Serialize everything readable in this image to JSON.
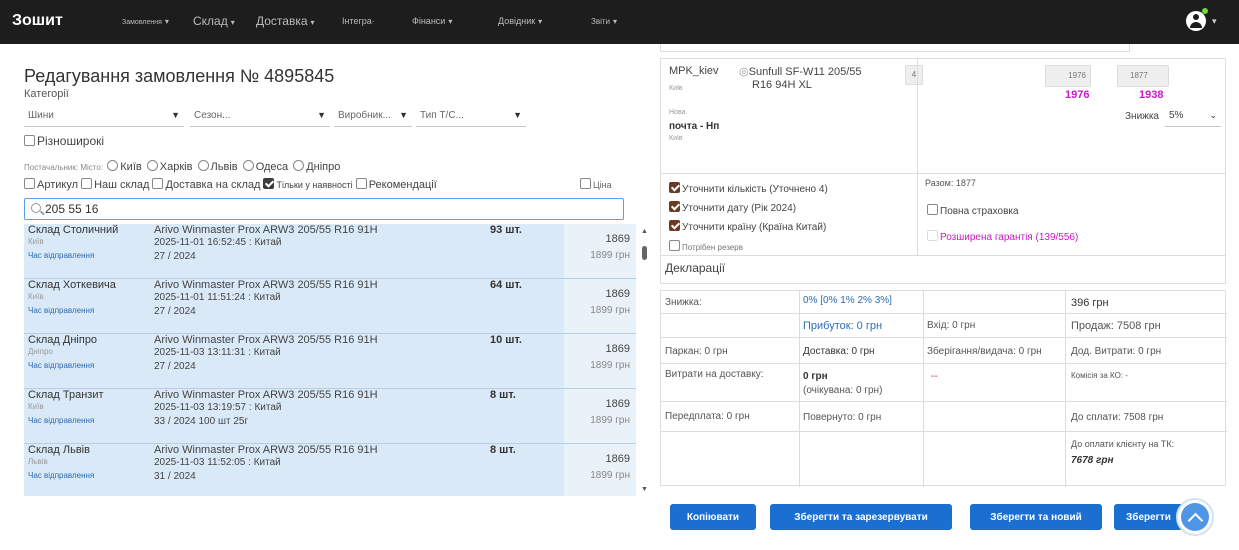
{
  "app": {
    "title": "Зошит"
  },
  "nav": [
    "Замовлення",
    "Склад",
    "Доставка",
    "Інтегра·",
    "Фінанси",
    "Довідник",
    "Звіти"
  ],
  "left": {
    "page_title": "Редагування замовлення № 4895845",
    "categories_label": "Категорії",
    "filters": {
      "type": "Шини",
      "season": "Сезон...",
      "manufacturer": "Виробник...",
      "vehicle": "Тип Т/С..."
    },
    "wide_label": "Різноширокі",
    "suppliers_prefix": "Постачальник: Місто:",
    "cities": [
      "Київ",
      "Харків",
      "Львів",
      "Одеса",
      "Дніпро"
    ],
    "options": {
      "article": "Артикул",
      "our_warehouse": "Наш склад",
      "delivery_warehouse": "Доставка на склад",
      "in_stock": "Тільки у наявності",
      "recommendations": "Рекомендації",
      "price": "Ціна"
    },
    "search_value": "205 55 16",
    "rows": [
      {
        "warehouse": "Склад Столичний",
        "city": "Київ",
        "ship": "Час відправлення",
        "name": "Arivo Winmaster Prox ARW3 205/55 R16 91H",
        "date": "2025-11-01 16:52:45 : Китай",
        "year": "27 / 2024",
        "qty": "93 шт.",
        "price": "1869",
        "price_old": "1899 грн"
      },
      {
        "warehouse": "Склад Хоткевича",
        "city": "Київ",
        "ship": "Час відправлення",
        "name": "Arivo Winmaster Prox ARW3 205/55 R16 91H",
        "date": "2025-11-01 11:51:24 : Китай",
        "year": "27 / 2024",
        "qty": "64 шт.",
        "price": "1869",
        "price_old": "1899 грн"
      },
      {
        "warehouse": "Склад Дніпро",
        "city": "Дніпро",
        "ship": "Час відправлення",
        "name": "Arivo Winmaster Prox ARW3 205/55 R16 91H",
        "date": "2025-11-03 13:11:31 : Китай",
        "year": "27 / 2024",
        "qty": "10 шт.",
        "price": "1869",
        "price_old": "1899 грн"
      },
      {
        "warehouse": "Склад Транзит",
        "city": "Київ",
        "ship": "Час відправлення",
        "name": "Arivo Winmaster Prox ARW3 205/55 R16 91H",
        "date": "2025-11-03 13:19:57 : Китай",
        "year": "33 / 2024 100 шт 25г",
        "qty": "8 шт.",
        "price": "1869",
        "price_old": "1899 грн"
      },
      {
        "warehouse": "Склад Львів",
        "city": "Львів",
        "ship": "Час відправлення",
        "name": "Arivo Winmaster Prox ARW3 205/55 R16 91H",
        "date": "2025-11-03 11:52:05 : Китай",
        "year": "31 / 2024",
        "qty": "8 шт.",
        "price": "1869",
        "price_old": "1899 грн"
      }
    ]
  },
  "right": {
    "item": {
      "supplier": "MPK_kiev",
      "supplier_city": "Київ",
      "delivery_small": "Нова",
      "delivery": "почта - Нп",
      "delivery_city": "Київ",
      "product": "Sunfull SF-W11 205/55",
      "product2": "R16 94H XL",
      "qty": "4",
      "cost1": "1976",
      "cost1_pink": "1976",
      "cost2": "1877",
      "cost2_pink": "1938",
      "discount_label": "Знижка",
      "discount_value": "5%"
    },
    "checks": {
      "qty": "Уточнити кількість (Уточнено 4)",
      "date": "Уточнити дату (Рік 2024)",
      "country": "Уточнити країну (Країна Китай)",
      "reserve": "Потрібен резерв",
      "total": "Разом: 1877",
      "insurance": "Повна страховка",
      "warranty": "Розширена гарантія (139/556)",
      "declarations": "Декларації"
    },
    "summary": {
      "discount_label": "Знижка:",
      "discount_value": "0% [0% 1% 2% 3%]",
      "discount_amount": "396 грн",
      "profit": "Прибуток: 0 грн",
      "entry": "Вхід: 0 грн",
      "sale": "Продаж: 7508 грн",
      "parking": "Паркан: 0 грн",
      "delivery": "Доставка: 0 грн",
      "storage": "Зберігання/видача: 0 грн",
      "extra": "Дод. Витрати: 0 грн",
      "delivery_cost_label": "Витрати на доставку:",
      "delivery_cost": "0 грн",
      "delivery_expected": "(очікувана: 0 грн)",
      "dash": "--",
      "ko": "Комісія за КО: -",
      "prepay": "Передплата: 0 грн",
      "returned": "Повернуто: 0 грн",
      "to_pay": "До сплати: 7508 грн",
      "client_pay_label": "До оплати клієнту на ТК:",
      "client_pay": "7678 грн"
    },
    "buttons": {
      "copy": "Копіювати",
      "save_reserve": "Зберегти та зарезервувати",
      "save_new": "Зберегти та новий",
      "save": "Зберегти"
    }
  }
}
